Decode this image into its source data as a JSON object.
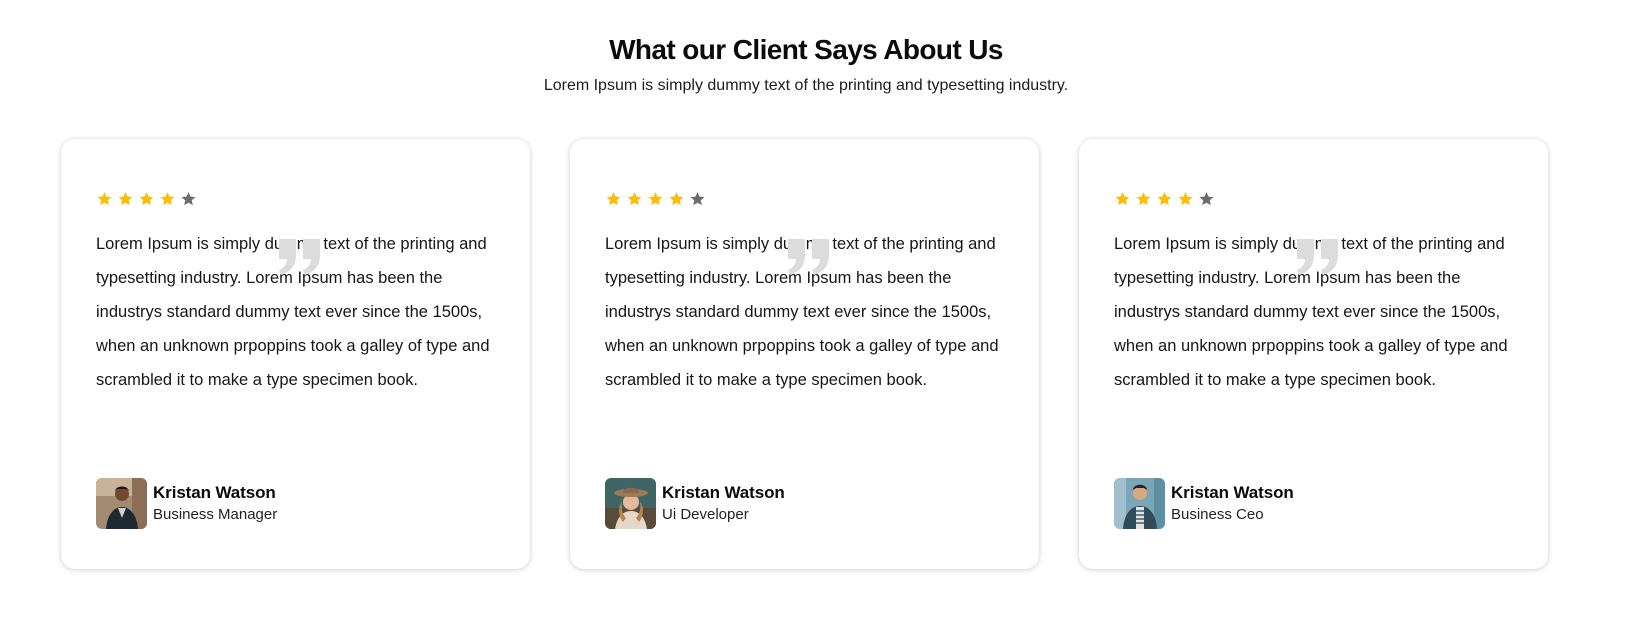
{
  "section": {
    "title": "What our Client Says About Us",
    "subtitle": "Lorem Ipsum is simply dummy text of the printing and typesetting industry."
  },
  "colors": {
    "star_filled": "#fbbc0a",
    "star_empty": "#6d6d6d",
    "quote_mark": "#dcdcdc"
  },
  "testimonials": [
    {
      "rating": 4,
      "max_rating": 5,
      "text": "Lorem Ipsum is simply dummy text of the printing and typesetting industry. Lorem Ipsum has been the industrys standard dummy text ever since the 1500s, when an unknown prpoppins took a galley of type and scrambled it to make a type specimen book.",
      "name": "Kristan Watson",
      "role": "Business Manager",
      "avatar_icon": "avatar-photo-man-dark-jacket"
    },
    {
      "rating": 4,
      "max_rating": 5,
      "text": "Lorem Ipsum is simply dummy text of the printing and typesetting industry. Lorem Ipsum has been the industrys standard dummy text ever since the 1500s, when an unknown prpoppins took a galley of type and scrambled it to make a type specimen book.",
      "name": "Kristan Watson",
      "role": "Ui Developer",
      "avatar_icon": "avatar-photo-woman-hat"
    },
    {
      "rating": 4,
      "max_rating": 5,
      "text": "Lorem Ipsum is simply dummy text of the printing and typesetting industry. Lorem Ipsum has been the industrys standard dummy text ever since the 1500s, when an unknown prpoppins took a galley of type and scrambled it to make a type specimen book.",
      "name": "Kristan Watson",
      "role": "Business Ceo",
      "avatar_icon": "avatar-photo-man-striped-shirt"
    }
  ]
}
